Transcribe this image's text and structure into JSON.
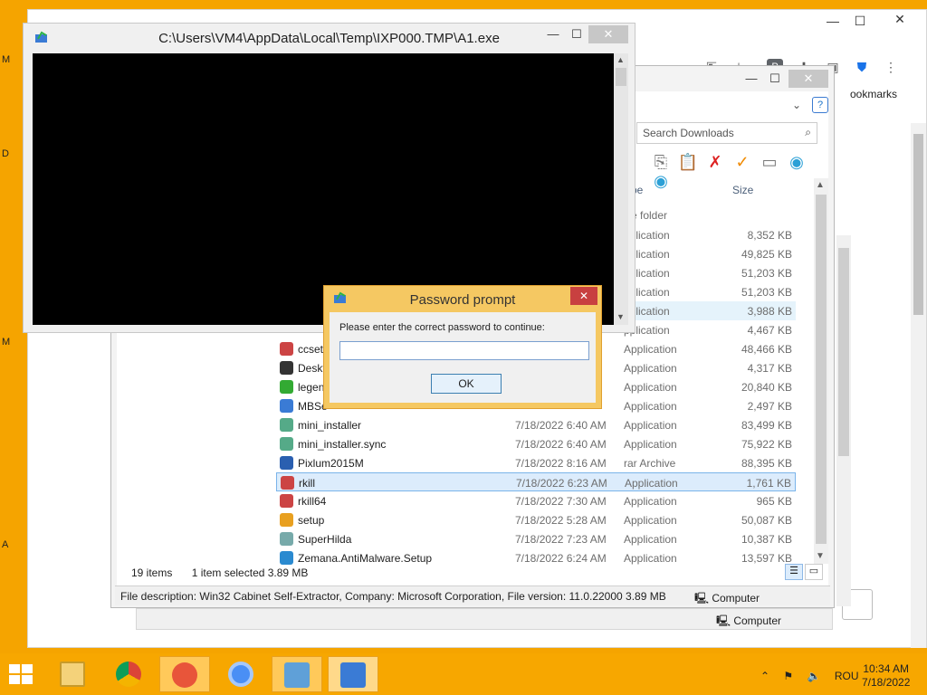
{
  "desktop": {
    "side_letters": [
      "M",
      "D",
      "M",
      "A"
    ]
  },
  "chrome": {
    "bookmarks_label": "ookmarks",
    "controls": {
      "minimize": "—",
      "maximize": "☐",
      "close": "✕"
    },
    "toolbar_icons": [
      "share-icon",
      "star-icon",
      "extension-p-icon",
      "puzzle-icon",
      "sidepanel-icon",
      "shield-check-icon",
      "menu-dots-icon"
    ]
  },
  "explorer": {
    "controls": {
      "minimize": "—",
      "maximize": "☐",
      "close": "✕"
    },
    "search_placeholder": "Search Downloads",
    "columns": {
      "type": "pe",
      "size": "Size"
    },
    "folder_label": "e folder",
    "rows": [
      {
        "name": "",
        "date": "",
        "type": "pplication",
        "size": "8,352 KB"
      },
      {
        "name": "",
        "date": "",
        "type": "pplication",
        "size": "49,825 KB"
      },
      {
        "name": "",
        "date": "",
        "type": "pplication",
        "size": "51,203 KB"
      },
      {
        "name": "",
        "date": "",
        "type": "pplication",
        "size": "51,203 KB"
      },
      {
        "name": "",
        "date": "",
        "type": "pplication",
        "size": "3,988 KB"
      },
      {
        "name": "",
        "date": "",
        "type": "pplication",
        "size": "4,467 KB"
      },
      {
        "name": "ccset",
        "date": "",
        "type": "Application",
        "size": "48,466 KB"
      },
      {
        "name": "Deskt",
        "date": "",
        "type": "Application",
        "size": "4,317 KB"
      },
      {
        "name": "legen",
        "date": "",
        "type": "Application",
        "size": "20,840 KB"
      },
      {
        "name": "MBSe",
        "date": "",
        "type": "Application",
        "size": "2,497 KB"
      },
      {
        "name": "mini_installer",
        "date": "7/18/2022 6:40 AM",
        "type": "Application",
        "size": "83,499 KB"
      },
      {
        "name": "mini_installer.sync",
        "date": "7/18/2022 6:40 AM",
        "type": "Application",
        "size": "75,922 KB"
      },
      {
        "name": "Pixlum2015M",
        "date": "7/18/2022 8:16 AM",
        "type": "rar Archive",
        "size": "88,395 KB"
      },
      {
        "name": "rkill",
        "date": "7/18/2022 6:23 AM",
        "type": "Application",
        "size": "1,761 KB"
      },
      {
        "name": "rkill64",
        "date": "7/18/2022 7:30 AM",
        "type": "Application",
        "size": "965 KB"
      },
      {
        "name": "setup",
        "date": "7/18/2022 5:28 AM",
        "type": "Application",
        "size": "50,087 KB"
      },
      {
        "name": "SuperHilda",
        "date": "7/18/2022 7:23 AM",
        "type": "Application",
        "size": "10,387 KB"
      },
      {
        "name": "Zemana.AntiMalware.Setup",
        "date": "7/18/2022 6:24 AM",
        "type": "Application",
        "size": "13,597 KB"
      }
    ],
    "status_items": "19 items",
    "status_selected": "1 item selected  3.89 MB",
    "details_text": "File description: Win32 Cabinet Self-Extractor, Company: Microsoft Corporation, File version: 11.0.22000  3.89 MB",
    "details_location": "Computer",
    "back_location": "Computer",
    "colors": {
      "selection": "#dcecfc",
      "selection_border": "#7ab4ea"
    }
  },
  "console": {
    "title": "C:\\Users\\VM4\\AppData\\Local\\Temp\\IXP000.TMP\\A1.exe",
    "controls": {
      "minimize": "—",
      "maximize": "☐",
      "close": "✕"
    }
  },
  "password_dialog": {
    "title": "Password prompt",
    "label": "Please enter the correct password to continue:",
    "input_value": "",
    "ok_label": "OK",
    "close": "✕"
  },
  "taskbar": {
    "items": [
      "file-explorer-icon",
      "chrome-icon",
      "avast-icon",
      "chromium-icon",
      "control-panel-icon",
      "installer-icon"
    ],
    "tray_lang": "ROU",
    "time": "10:34 AM",
    "date": "7/18/2022",
    "colors": {
      "taskbar": "#f7a700",
      "desktop": "#f5a400"
    }
  }
}
